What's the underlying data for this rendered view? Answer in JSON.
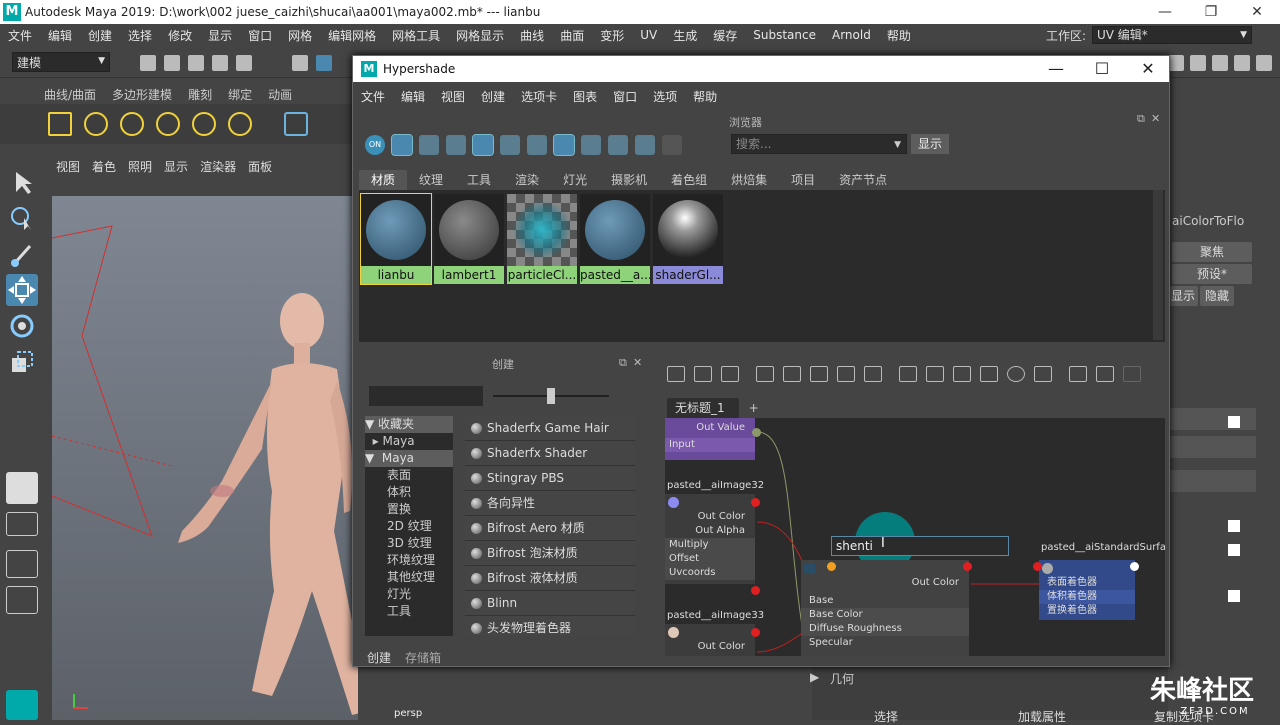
{
  "window": {
    "title": "Autodesk Maya 2019: D:\\work\\002 juese_caizhi\\shucai\\aa001\\maya002.mb*   ---   lianbu"
  },
  "menubar": {
    "items": [
      "文件",
      "编辑",
      "创建",
      "选择",
      "修改",
      "显示",
      "窗口",
      "网格",
      "编辑网格",
      "网格工具",
      "网格显示",
      "曲线",
      "曲面",
      "变形",
      "UV",
      "生成",
      "缓存",
      "Substance",
      "Arnold",
      "帮助"
    ],
    "workspace_label": "工作区:",
    "workspace_value": "UV 编辑*"
  },
  "toolbar": {
    "mode": "建模"
  },
  "shelf": {
    "tabs": [
      "曲线/曲面",
      "多边形建模",
      "雕刻",
      "绑定",
      "动画"
    ]
  },
  "viewport": {
    "menu": [
      "视图",
      "着色",
      "照明",
      "显示",
      "渲染器",
      "面板"
    ],
    "camera": "persp"
  },
  "rightpanel": {
    "node_name": "aiColorToFlo",
    "focus": "聚焦",
    "preset": "预设*",
    "show": "显示",
    "hide": "隐藏"
  },
  "attribute_editor": {
    "section": "几何",
    "select": "选择",
    "load_attrs": "加载属性",
    "copy_tab": "复制选项卡"
  },
  "hypershade": {
    "title": "Hypershade",
    "menu": [
      "文件",
      "编辑",
      "视图",
      "创建",
      "选项卡",
      "图表",
      "窗口",
      "选项",
      "帮助"
    ],
    "browser_label": "浏览器",
    "on_label": "ON",
    "search_placeholder": "搜索...",
    "show_button": "显示",
    "tabs": [
      "材质",
      "纹理",
      "工具",
      "渲染",
      "灯光",
      "摄影机",
      "着色组",
      "烘焙集",
      "项目",
      "资产节点"
    ],
    "swatches": [
      {
        "label": "lianbu",
        "label_color": "#8ed27a"
      },
      {
        "label": "lambert1",
        "label_color": "#8ed27a"
      },
      {
        "label": "particleCl...",
        "label_color": "#8ed27a"
      },
      {
        "label": "pasted__a...",
        "label_color": "#8ed27a"
      },
      {
        "label": "shaderGl...",
        "label_color": "#8a8ad8"
      }
    ],
    "create_label": "创建",
    "categories": [
      "收藏夹",
      "Maya",
      "Maya",
      "表面",
      "体积",
      "置换",
      "2D 纹理",
      "3D 纹理",
      "环境纹理",
      "其他纹理",
      "灯光",
      "工具"
    ],
    "shaders": [
      "Shaderfx Game Hair",
      "Shaderfx Shader",
      "Stingray PBS",
      "各向异性",
      "Bifrost Aero 材质",
      "Bifrost 泡沫材质",
      "Bifrost 液体材质",
      "Blinn",
      "头发物理着色器"
    ],
    "bottom_tabs": [
      "创建",
      "存储箱"
    ],
    "graph_tab": "无标题_1",
    "graph_tab_add": "+",
    "nodes": {
      "top_out": "Out Value",
      "top_in": "Input",
      "img32_title": "pasted__aiImage32",
      "img32_rows": [
        "Out Color",
        "Out Alpha",
        "Multiply",
        "Offset",
        "Uvcoords"
      ],
      "img33_title": "pasted__aiImage33",
      "img33_rows": [
        "Out Color"
      ],
      "std_rename": "shenti",
      "std_rows": [
        "Out Color",
        "Base",
        "Base Color",
        "Diffuse Roughness",
        "Specular"
      ],
      "sg_title": "pasted__aiStandardSurfa",
      "sg_rows": [
        "表面着色器",
        "体积着色器",
        "置换着色器"
      ]
    }
  },
  "watermark": {
    "brand": "朱峰社区",
    "site": "ZF3D.COM"
  }
}
